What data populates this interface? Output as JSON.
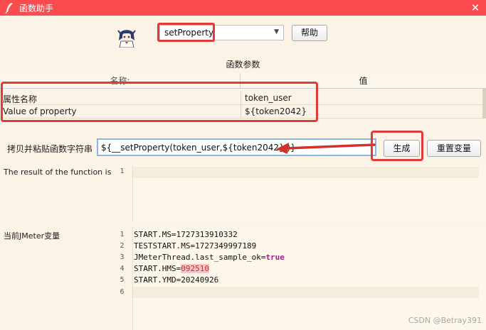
{
  "window": {
    "title": "函数助手"
  },
  "function_select": {
    "value": "setProperty"
  },
  "toolbar": {
    "help_label": "帮助",
    "generate_label": "生成",
    "reset_label": "重置变量"
  },
  "params": {
    "section_label": "函数参数",
    "columns": [
      "名称:",
      "值"
    ],
    "rows": [
      {
        "name": "属性名称",
        "value": "token_user"
      },
      {
        "name": "Value of property",
        "value": "${token2042}"
      }
    ]
  },
  "copy": {
    "label": "拷贝并粘贴函数字符串",
    "value": "${__setProperty(token_user,${token2042},)}"
  },
  "result": {
    "label": "The result of the function is",
    "line_numbers": [
      "1"
    ]
  },
  "vars": {
    "label": "当前JMeter变量",
    "line_numbers": [
      "1",
      "2",
      "3",
      "4",
      "5",
      "6"
    ],
    "lines": [
      {
        "key": "START.MS=",
        "value": "1727313910332"
      },
      {
        "key": "TESTSTART.MS=",
        "value": "1727349997189"
      },
      {
        "key": "JMeterThread.last_sample_ok=",
        "value": "true"
      },
      {
        "key": "START.HMS=",
        "value": "092510"
      },
      {
        "key": "START.YMD=",
        "value": "20240926"
      }
    ]
  },
  "watermark": "CSDN @Betray391",
  "colors": {
    "titlebar": "#fc4b4e",
    "highlight": "#e03a3a",
    "field_border": "#86b5e6"
  },
  "icons": [
    "feather-icon",
    "close-icon",
    "avatar-icon",
    "chevron-down-icon",
    "arrow-left-icon"
  ]
}
